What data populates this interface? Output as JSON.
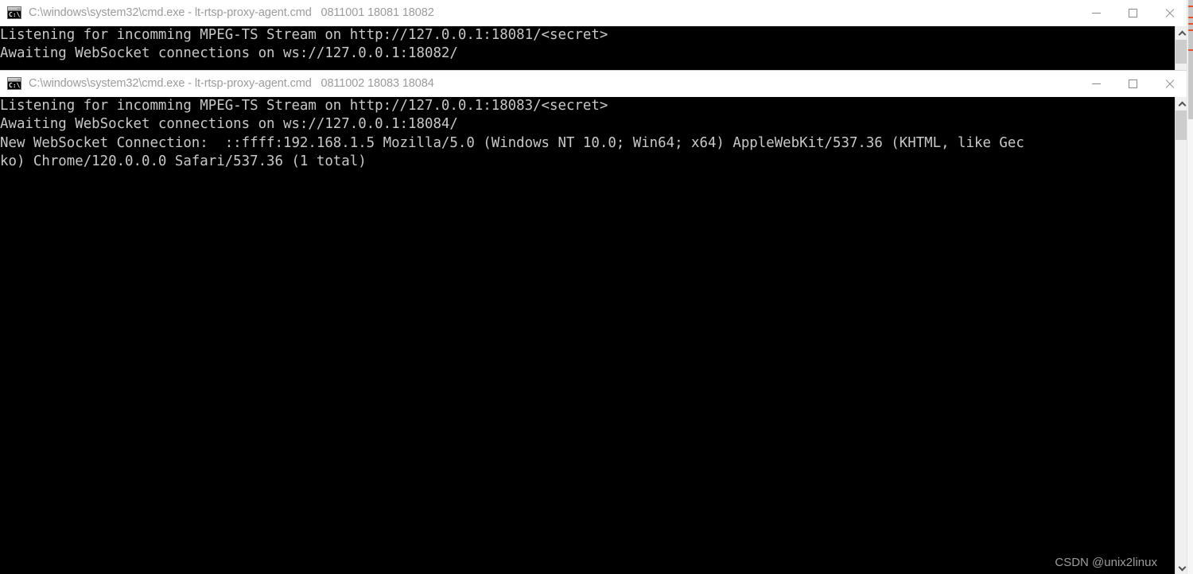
{
  "windows": [
    {
      "icon_name": "cmd-exe-icon",
      "icon_prompt": "C:\\",
      "title": "C:\\windows\\system32\\cmd.exe - lt-rtsp-proxy-agent.cmd   0811001 18081 18082",
      "controls": {
        "minimize_label": "Minimize",
        "maximize_label": "Maximize",
        "close_label": "Close"
      },
      "console_text": "Listening for incomming MPEG-TS Stream on http://127.0.0.1:18081/<secret>\nAwaiting WebSocket connections on ws://127.0.0.1:18082/"
    },
    {
      "icon_name": "cmd-exe-icon",
      "icon_prompt": "C:\\",
      "title": "C:\\windows\\system32\\cmd.exe - lt-rtsp-proxy-agent.cmd   0811002 18083 18084",
      "controls": {
        "minimize_label": "Minimize",
        "maximize_label": "Maximize",
        "close_label": "Close"
      },
      "console_text": "Listening for incomming MPEG-TS Stream on http://127.0.0.1:18083/<secret>\nAwaiting WebSocket connections on ws://127.0.0.1:18084/\nNew WebSocket Connection:  ::ffff:192.168.1.5 Mozilla/5.0 (Windows NT 10.0; Win64; x64) AppleWebKit/537.36 (KHTML, like Gec\nko) Chrome/120.0.0.0 Safari/537.36 (1 total)"
    }
  ],
  "watermark": "CSDN @unix2linux",
  "colors": {
    "console_background": "#000000",
    "console_text": "#c8c8c8",
    "title_text": "#9b9b9b",
    "titlebar_background": "#ffffff",
    "scrollbar_track": "#f0f0f0",
    "scrollbar_thumb": "#cdcdcd",
    "search_marker": "#e8502a"
  }
}
